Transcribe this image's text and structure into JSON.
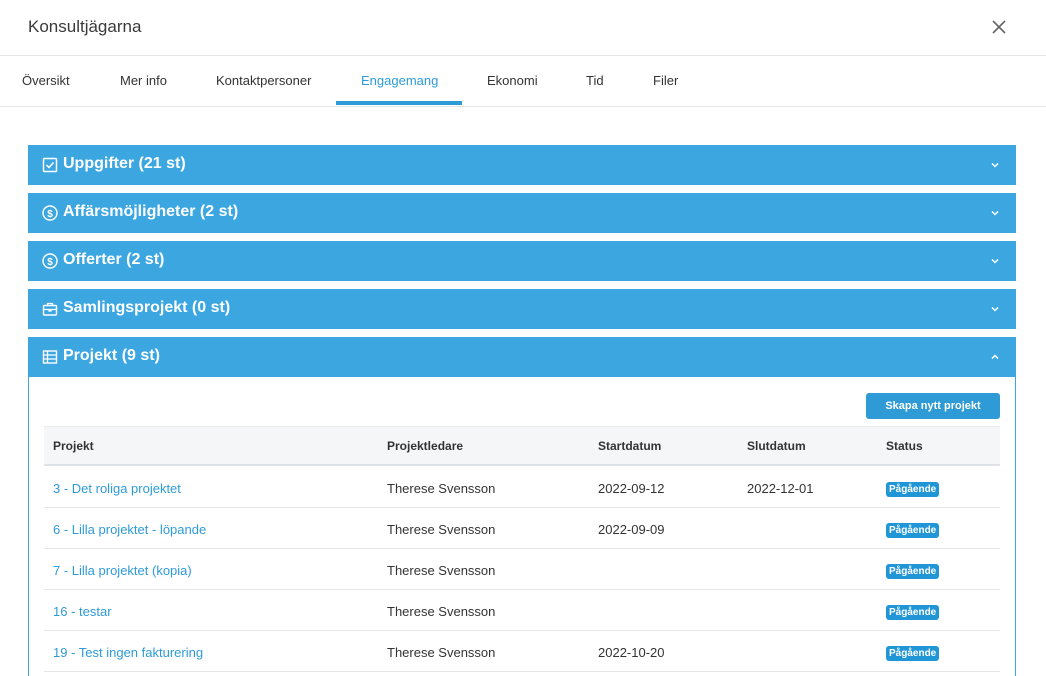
{
  "window": {
    "title": "Konsultjägarna"
  },
  "tabs": [
    {
      "label": "Översikt"
    },
    {
      "label": "Mer info"
    },
    {
      "label": "Kontaktpersoner"
    },
    {
      "label": "Engagemang",
      "active": true
    },
    {
      "label": "Ekonomi"
    },
    {
      "label": "Tid"
    },
    {
      "label": "Filer"
    }
  ],
  "sections": [
    {
      "label": "Uppgifter (21 st)",
      "icon": "checkbox-icon",
      "expanded": false
    },
    {
      "label": "Affärsmöjligheter (2 st)",
      "icon": "dollar-circle-icon",
      "expanded": false
    },
    {
      "label": "Offerter (2 st)",
      "icon": "dollar-circle-icon",
      "expanded": false
    },
    {
      "label": "Samlingsprojekt (0 st)",
      "icon": "briefcase-icon",
      "expanded": false
    },
    {
      "label": "Projekt (9 st)",
      "icon": "table-icon",
      "expanded": true
    }
  ],
  "projects": {
    "create_button": "Skapa nytt projekt",
    "columns": [
      "Projekt",
      "Projektledare",
      "Startdatum",
      "Slutdatum",
      "Status"
    ],
    "rows": [
      {
        "name": "3 - Det roliga projektet",
        "manager": "Therese Svensson",
        "start": "2022-09-12",
        "end": "2022-12-01",
        "status": "Pågående"
      },
      {
        "name": "6 - Lilla projektet - löpande",
        "manager": "Therese Svensson",
        "start": "2022-09-09",
        "end": "",
        "status": "Pågående"
      },
      {
        "name": "7 - Lilla projektet (kopia)",
        "manager": "Therese Svensson",
        "start": "",
        "end": "",
        "status": "Pågående"
      },
      {
        "name": "16 - testar",
        "manager": "Therese Svensson",
        "start": "",
        "end": "",
        "status": "Pågående"
      },
      {
        "name": "19 - Test ingen fakturering",
        "manager": "Therese Svensson",
        "start": "2022-10-20",
        "end": "",
        "status": "Pågående"
      }
    ]
  },
  "colors": {
    "accent": "#2e9bd6",
    "panel": "#3ba6e0",
    "badge": "#2196d6"
  }
}
